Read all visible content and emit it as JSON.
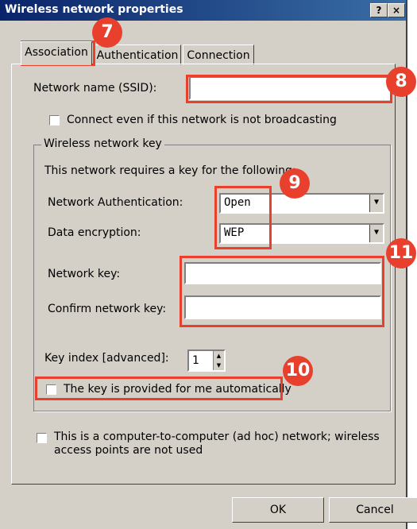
{
  "window": {
    "title": "Wireless network properties",
    "help_button": "?",
    "close_button": "×"
  },
  "tabs": [
    {
      "label": "Association"
    },
    {
      "label": "Authentication"
    },
    {
      "label": "Connection"
    }
  ],
  "association": {
    "ssid_label": "Network name (SSID):",
    "ssid_value": "",
    "broadcast_checkbox_label": "Connect even if this network is not broadcasting",
    "broadcast_checked": false,
    "group_title": "Wireless network key",
    "requires_key_text": "This network requires a key for the following:",
    "auth_label": "Network Authentication:",
    "auth_value": "Open",
    "encryption_label": "Data encryption:",
    "encryption_value": "WEP",
    "network_key_label": "Network key:",
    "network_key_value": "",
    "confirm_key_label": "Confirm network key:",
    "confirm_key_value": "",
    "key_index_label": "Key index [advanced]:",
    "key_index_value": "1",
    "auto_key_label": "The key is provided for me automatically",
    "auto_key_checked": false,
    "adhoc_label_line1": "This is a computer-to-computer (ad hoc) network; wireless",
    "adhoc_label_line2": "access points are not used",
    "adhoc_checked": false
  },
  "buttons": {
    "ok": "OK",
    "cancel": "Cancel"
  },
  "callouts": {
    "color": "#e8402d",
    "badge_7": "7",
    "badge_8": "8",
    "badge_9": "9",
    "badge_10": "10",
    "badge_11": "11"
  }
}
